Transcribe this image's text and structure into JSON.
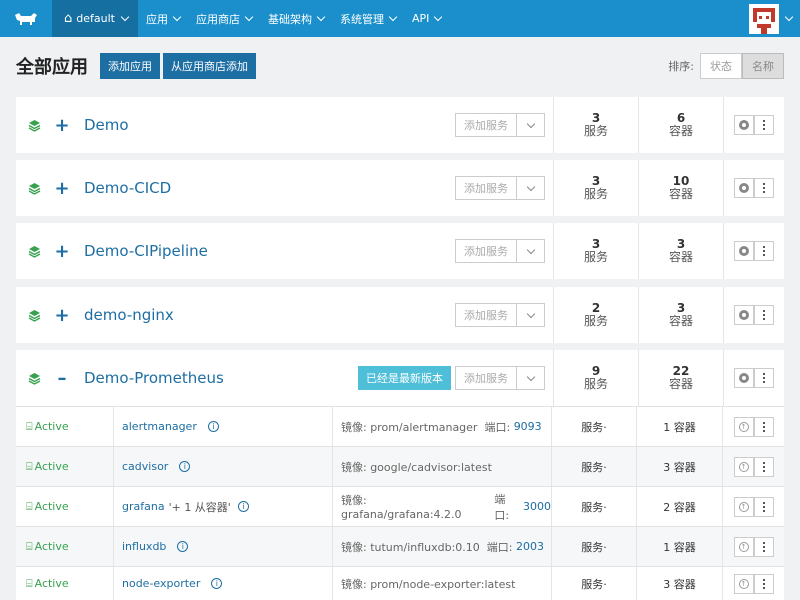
{
  "nav": {
    "environment": "default",
    "items": [
      {
        "label": "应用"
      },
      {
        "label": "应用商店"
      },
      {
        "label": "基础架构"
      },
      {
        "label": "系统管理"
      },
      {
        "label": "API"
      }
    ]
  },
  "header": {
    "title": "全部应用",
    "add_stack": "添加应用",
    "add_from_catalog": "从应用商店添加",
    "sort_label": "排序:",
    "sort_state": "状态",
    "sort_name": "名称"
  },
  "common": {
    "add_service": "添加服务",
    "services_label": "服务",
    "containers_label": "容器",
    "expand_symbol": "+",
    "collapse_symbol": "–"
  },
  "stacks": [
    {
      "name": "Demo",
      "services": "3",
      "containers": "6"
    },
    {
      "name": "Demo-CICD",
      "services": "3",
      "containers": "10"
    },
    {
      "name": "Demo-CIPipeline",
      "services": "3",
      "containers": "3"
    },
    {
      "name": "demo-nginx",
      "services": "2",
      "containers": "3"
    },
    {
      "name": "Demo-Prometheus",
      "services": "9",
      "containers": "22",
      "badge": "已经是最新版本"
    }
  ],
  "service_rows": [
    {
      "state": "Active",
      "name": "alertmanager",
      "extra": "",
      "image": "镜像: prom/alertmanager",
      "port_label": "端口:",
      "port": "9093",
      "scale": "服务·",
      "containers": "1 容器"
    },
    {
      "state": "Active",
      "name": "cadvisor",
      "extra": "",
      "image": "镜像: google/cadvisor:latest",
      "port_label": "",
      "port": "",
      "scale": "服务·",
      "containers": "3 容器"
    },
    {
      "state": "Active",
      "name": "grafana",
      "extra": "'+ 1 从容器'",
      "image": "镜像: grafana/grafana:4.2.0",
      "port_label": "端口:",
      "port": "3000",
      "scale": "服务·",
      "containers": "2 容器"
    },
    {
      "state": "Active",
      "name": "influxdb",
      "extra": "",
      "image": "镜像: tutum/influxdb:0.10",
      "port_label": "端口:",
      "port": "2003",
      "scale": "服务·",
      "containers": "1 容器"
    },
    {
      "state": "Active",
      "name": "node-exporter",
      "extra": "",
      "image": "镜像: prom/node-exporter:latest",
      "port_label": "",
      "port": "",
      "scale": "服务·",
      "containers": "3 容器"
    }
  ],
  "colors": {
    "brand": "#1a8fcb",
    "link": "#1d6ea3",
    "active": "#37a14f",
    "badge": "#4fbed8"
  }
}
